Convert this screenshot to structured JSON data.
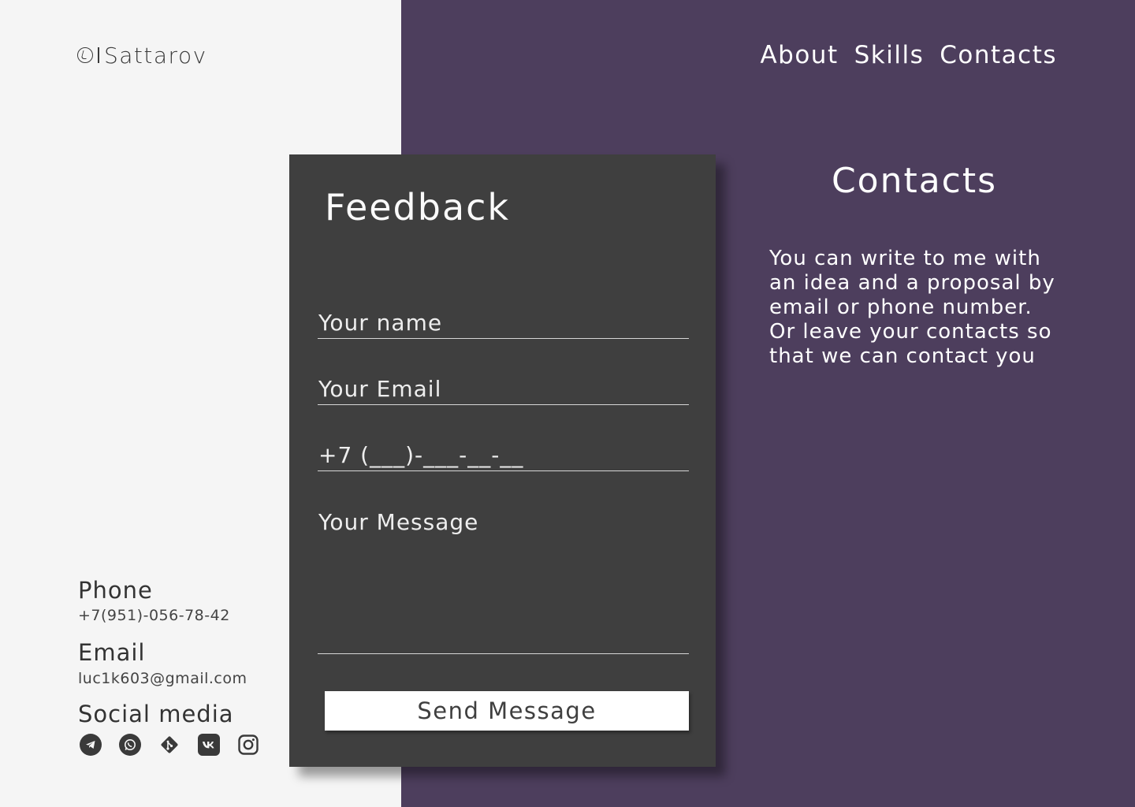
{
  "header": {
    "logo_text": "Sattarov",
    "nav": [
      "About",
      "Skills",
      "Contacts"
    ]
  },
  "form": {
    "title": "Feedback",
    "name_placeholder": "Your name",
    "email_placeholder": "Your Email",
    "phone_placeholder": "+7 (___)-___-__-__",
    "message_placeholder": "Your Message",
    "submit_label": "Send Message"
  },
  "contacts": {
    "title": "Contacts",
    "description_line1": "You can write to me with an idea and a proposal by email or phone number.",
    "description_line2": "Or leave your contacts so that we can contact you"
  },
  "info": {
    "phone_label": "Phone",
    "phone_value": "+7(951)-056-78-42",
    "email_label": "Email",
    "email_value": "luc1k603@gmail.com",
    "social_label": "Social media",
    "social_icons": [
      "telegram-icon",
      "whatsapp-icon",
      "git-icon",
      "vk-icon",
      "instagram-icon"
    ]
  },
  "colors": {
    "left_background": "#f5f5f5",
    "right_background": "#4d3e5d",
    "card_background": "#3f3f3f",
    "button_background": "#ffffff"
  }
}
